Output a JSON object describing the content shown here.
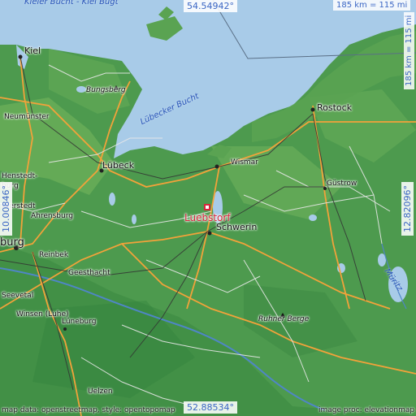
{
  "coords": {
    "top": "54.54942°",
    "bottom": "52.88534°",
    "left": "10.00846°",
    "right": "12.82096°"
  },
  "scale": {
    "horizontal": "185 km = 115 mi",
    "vertical": "185 km = 115 mi"
  },
  "marker": {
    "label": "Luebstorf",
    "color": "#d7263d",
    "icon": "square-marker"
  },
  "water_labels": {
    "kieler_bucht": "Kieler Bucht - Kiel Bugt",
    "luebecker_bucht": "Lübecker Bucht",
    "mueritz": "Müritz"
  },
  "places": {
    "kiel": "Kiel",
    "rostock": "Rostock",
    "bungsberg": "Bungsberg",
    "neumuenster": "Neumünster",
    "luebeck": "Lübeck",
    "wismar": "Wismar",
    "henstedt": "Henstedt-",
    "burg": "burg",
    "norderstedt": "rderstedt",
    "ahrensburg": "Ahrensburg",
    "hamburg": "burg",
    "reinbek": "Reinbek",
    "geesthacht": "Geesthacht",
    "seevetal": "Seevetal",
    "winsen": "Winsen (Luhe)",
    "lueneburg": "Lüneburg",
    "uelzen": "Uelzen",
    "guestrow": "Güstrow",
    "schwerin": "Schwerin",
    "ruhner_berge": "Ruhner Berge"
  },
  "footer": {
    "left": "map data: openstreetmap, style: opentopomap",
    "right": "image proc: elevationmap"
  },
  "colors": {
    "sea": "#a8cbe8",
    "land": "#4d9a4e",
    "road_major": "#f2a23a",
    "road_minor": "#dcdcdc",
    "rail": "#333333",
    "river": "#4f86c6"
  }
}
